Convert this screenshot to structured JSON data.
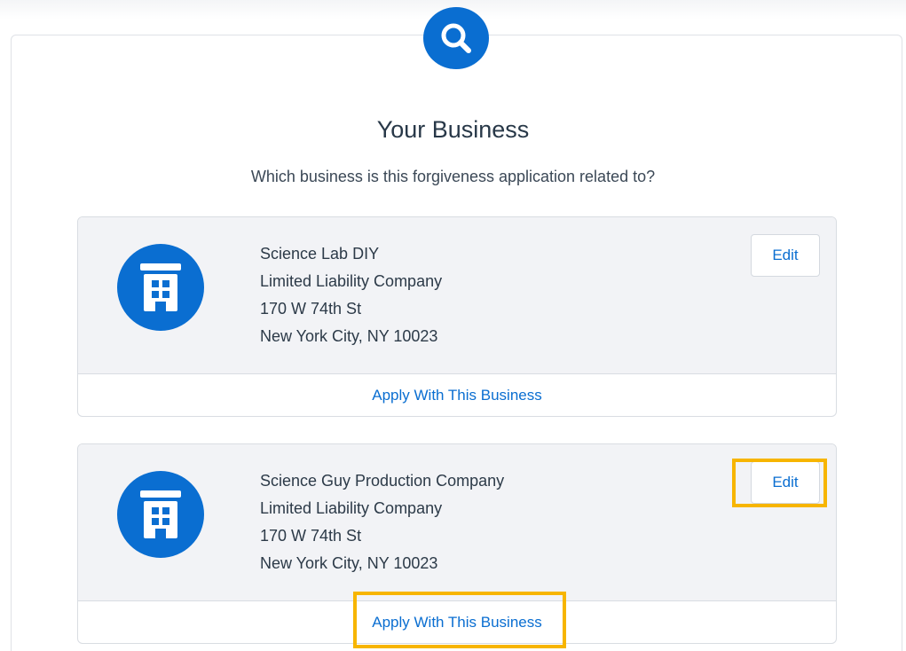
{
  "header": {
    "search_icon": "search-icon",
    "title": "Your Business",
    "subtitle": "Which business is this forgiveness application related to?"
  },
  "businesses": [
    {
      "name": "Science Lab DIY",
      "entity_type": "Limited Liability Company",
      "street": "170 W 74th St",
      "city_state_zip": "New York City, NY 10023",
      "icon": "building-icon",
      "edit_label": "Edit",
      "apply_label": "Apply With This Business"
    },
    {
      "name": "Science Guy Production Company",
      "entity_type": "Limited Liability Company",
      "street": "170 W 74th St",
      "city_state_zip": "New York City, NY 10023",
      "icon": "building-icon",
      "edit_label": "Edit",
      "apply_label": "Apply With This Business"
    }
  ],
  "colors": {
    "accent": "#0a6ed1",
    "highlight": "#f7b500",
    "card_top_bg": "#f2f3f6",
    "title_text": "#283848"
  }
}
